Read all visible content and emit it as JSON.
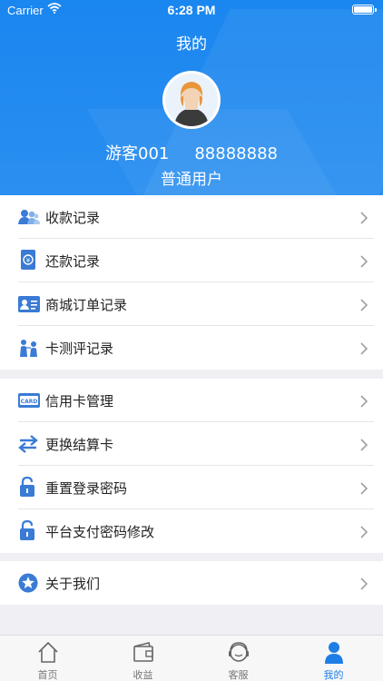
{
  "status_bar": {
    "carrier": "Carrier",
    "time": "6:28 PM"
  },
  "header": {
    "title": "我的",
    "username": "游客001",
    "user_id": "88888888",
    "user_type": "普通用户",
    "accent_color": "#1a86f0"
  },
  "menu_group_1": [
    {
      "label": "收款记录",
      "icon": "users-icon"
    },
    {
      "label": "还款记录",
      "icon": "payment-voucher-icon"
    },
    {
      "label": "商城订单记录",
      "icon": "order-card-icon"
    },
    {
      "label": "卡测评记录",
      "icon": "evaluation-icon"
    }
  ],
  "menu_group_2": [
    {
      "label": "信用卡管理",
      "icon": "card-icon"
    },
    {
      "label": "更换结算卡",
      "icon": "swap-arrows-icon"
    },
    {
      "label": "重置登录密码",
      "icon": "lock-icon"
    },
    {
      "label": "平台支付密码修改",
      "icon": "lock-icon"
    }
  ],
  "menu_group_3": [
    {
      "label": "关于我们",
      "icon": "star-icon"
    }
  ],
  "tabbar": {
    "items": [
      {
        "label": "首页",
        "icon": "home-icon"
      },
      {
        "label": "收益",
        "icon": "wallet-icon"
      },
      {
        "label": "客服",
        "icon": "headset-icon"
      },
      {
        "label": "我的",
        "icon": "person-icon"
      }
    ],
    "active_color": "#1f7ee6"
  }
}
